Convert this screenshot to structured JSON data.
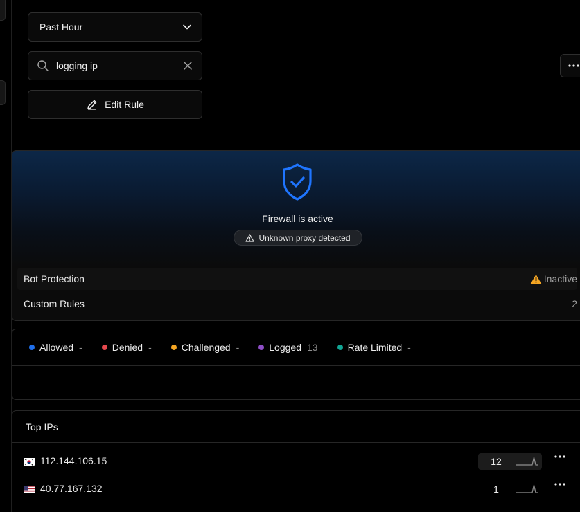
{
  "controls": {
    "timerange": {
      "value": "Past Hour"
    },
    "search": {
      "value": "logging ip"
    },
    "edit_label": "Edit Rule"
  },
  "firewall": {
    "title": "Firewall is active",
    "badge": "Unknown proxy detected",
    "rows": [
      {
        "label": "Bot Protection",
        "value": "Inactive",
        "status_icon": "warning-icon"
      },
      {
        "label": "Custom Rules",
        "value": "2"
      }
    ]
  },
  "legend": [
    {
      "label": "Allowed",
      "count": "-",
      "color": "#1f6feb"
    },
    {
      "label": "Denied",
      "count": "-",
      "color": "#e5484d"
    },
    {
      "label": "Challenged",
      "count": "-",
      "color": "#f5a623"
    },
    {
      "label": "Logged",
      "count": "13",
      "color": "#8e4ec6"
    },
    {
      "label": "Rate Limited",
      "count": "-",
      "color": "#12a594"
    }
  ],
  "top_ips": {
    "title": "Top IPs",
    "rows": [
      {
        "ip": "112.144.106.15",
        "count": "12",
        "flag": "kr-flag-icon"
      },
      {
        "ip": "40.77.167.132",
        "count": "1",
        "flag": "us-flag-icon"
      }
    ]
  },
  "colors": {
    "accent": "#1f75ff",
    "warning": "#f5a623",
    "border": "#262626"
  }
}
